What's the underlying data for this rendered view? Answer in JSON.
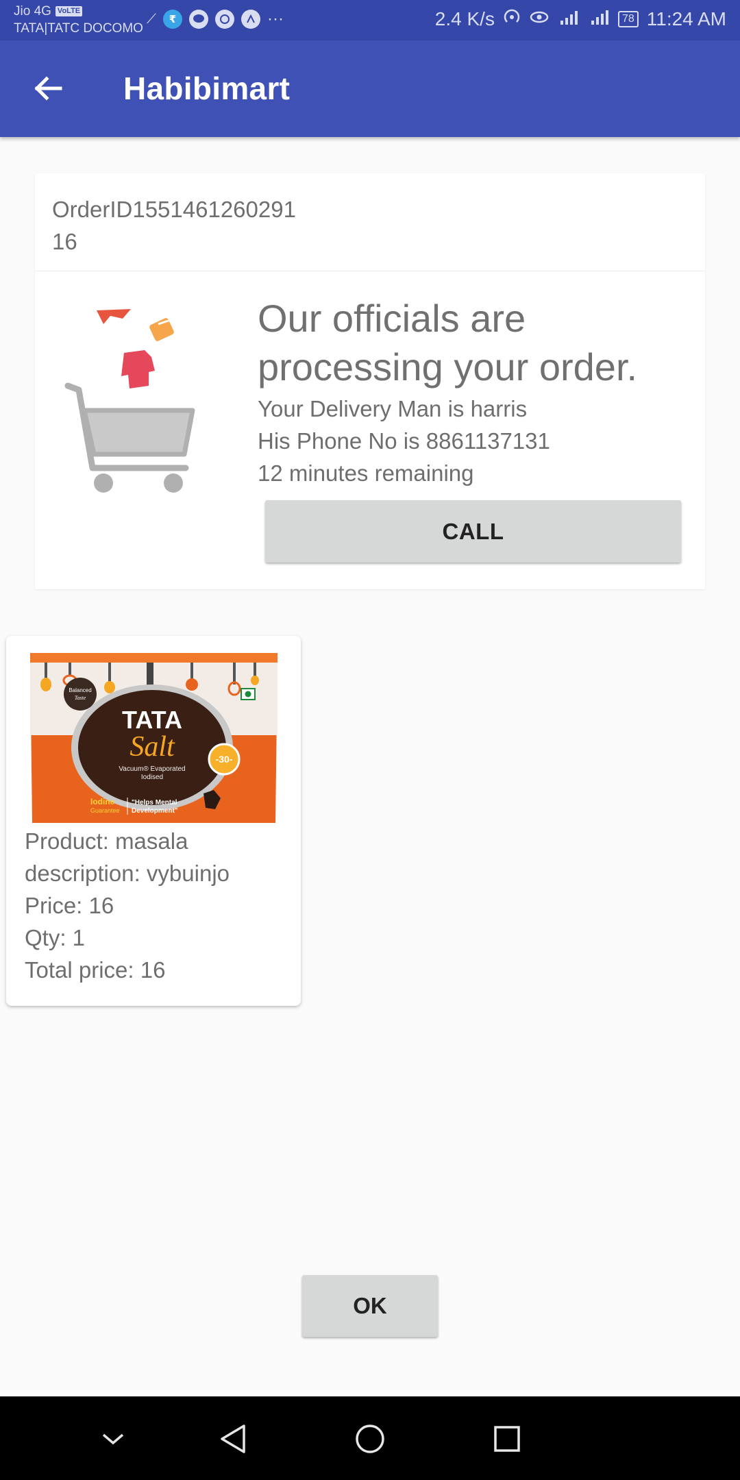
{
  "status_bar": {
    "carrier_line1": "Jio 4G",
    "volte": "VoLTE",
    "carrier_line2": "TATA|TATC DOCOMO",
    "notif_icon_2_glyph": "₹",
    "more_glyph": "···",
    "net_speed": "2.4 K/s",
    "signal_icon": "📶",
    "battery": "78",
    "time": "11:24 AM"
  },
  "app_bar": {
    "title": "Habibimart",
    "back_icon": "arrow-left-icon"
  },
  "order": {
    "id_line": "OrderID1551461260291",
    "amount_line": "16",
    "status_title": "Our officials are processing your order.",
    "delivery_man": "Your Delivery Man is harris",
    "phone": "His Phone No is 8861137131",
    "remaining": "12 minutes remaining",
    "call_label": "CALL"
  },
  "product": {
    "brand": "TATA",
    "name_on_pack": "Salt",
    "pack_sub1": "Vacuum® Evaporated",
    "pack_sub2": "Iodised",
    "pack_badge": "-30-",
    "pack_left1": "Iodine",
    "pack_left2": "Guarantee",
    "pack_right1": "\"Helps Mental",
    "pack_right2": "Development\"",
    "pack_seal1": "Balanced",
    "pack_seal2": "Taste",
    "product_line": "Product: masala",
    "description_line": "description: vybuinjo",
    "price_line": "Price: 16",
    "qty_line": "Qty: 1",
    "total_line": "Total price: 16"
  },
  "ok_label": "OK",
  "colors": {
    "status_bar": "#3547a8",
    "app_bar": "#3f51b5",
    "background": "#fafafa",
    "button": "#d6d7d7",
    "pack_orange": "#e8641e"
  }
}
